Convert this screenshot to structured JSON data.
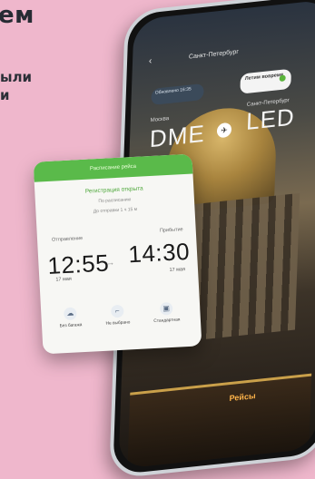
{
  "promo": {
    "headline": "ем",
    "line1": "ыли",
    "line2": "и"
  },
  "app": {
    "city_title": "Санкт-Петербург",
    "back_icon": "chevron-left-icon",
    "badge_left": "Обновлено 16:35",
    "badge_right": "Летим вовремя",
    "from_city": "Москва",
    "to_city": "Санкт-Петербург",
    "from_code": "DME",
    "to_code": "LED",
    "plane_icon": "plane-icon",
    "bus_sign": "Рейсы"
  },
  "card": {
    "header": "Расписание рейса",
    "status": "Регистрация открыта",
    "line1": "По расписанию",
    "line2": "До отправки 1 ч 15 м",
    "departure_label": "Отправление",
    "arrival_label": "Прибытие",
    "departure_time": "12:55",
    "arrival_time": "14:30",
    "departure_date": "17 мая",
    "arrival_date": "17 мая",
    "features": [
      {
        "icon": "cloud-icon",
        "label": "Без багажа"
      },
      {
        "icon": "seat-icon",
        "label": "Не выбрано"
      },
      {
        "icon": "bag-icon",
        "label": "Стандартная"
      }
    ]
  }
}
